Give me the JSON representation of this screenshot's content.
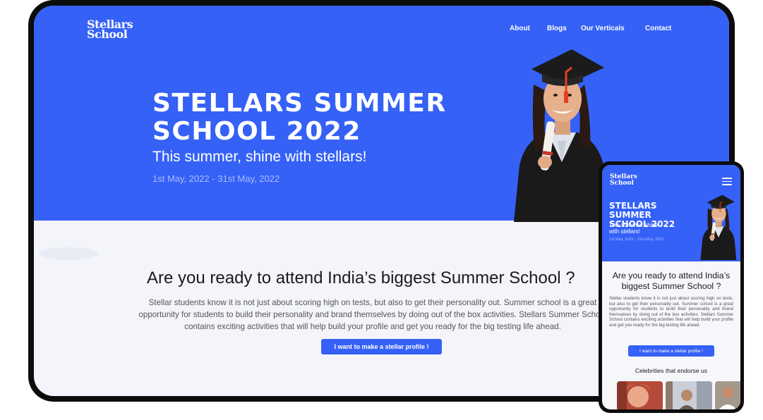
{
  "desktop": {
    "brand": {
      "line1": "Stellars",
      "line2": "School"
    },
    "nav": [
      "About",
      "Blogs",
      "Our Verticals",
      "Contact"
    ],
    "hero": {
      "title_line1": "STELLARS SUMMER",
      "title_line2": "SCHOOL 2022",
      "subtitle": "This summer, shine with stellars!",
      "dates": "1st May, 2022 - 31st May, 2022"
    },
    "section": {
      "title": "Are you ready to attend India’s biggest Summer School ?",
      "body": "Stellar students know it is not just about scoring high on tests, but also to get their personality out. Summer school is a great opportunity for students to build their personality and brand themselves by doing out of the box activities. Stellars Summer School contains exciting activities that will help build your profile and get you ready for the big testing life ahead.",
      "cta": "I want to make a stellar profile !"
    }
  },
  "mobile": {
    "brand": {
      "line1": "Stellars",
      "line2": "School"
    },
    "hero": {
      "title_line1": "STELLARS SUMMER",
      "title_line2": "SCHOOL 2022",
      "subtitle_line1": "This summer, shine",
      "subtitle_line2": "with stellars!",
      "dates": "1st May, 2022 - 31st May, 2022"
    },
    "section": {
      "title_line1": "Are you ready to attend India’s",
      "title_line2": "biggest Summer School ?",
      "body": "Stellar students know it is not just about scoring high on tests, but also to get their personality out. Summer school is a great opportunity for students to build their personality and brand themselves by doing out of the box activities. Stellars Summer School contains exciting activities that will help build your profile and get you ready for the big testing life ahead.",
      "cta": "I want to make a stellar profile !"
    },
    "celebrities_heading": "Celebrities that endorse us"
  },
  "colors": {
    "brand_blue": "#3561f6",
    "page_bg": "#f3f5fb",
    "frame": "#0c0c0c",
    "date_text": "#aabcff"
  },
  "icons": [
    "hamburger-menu-icon"
  ]
}
